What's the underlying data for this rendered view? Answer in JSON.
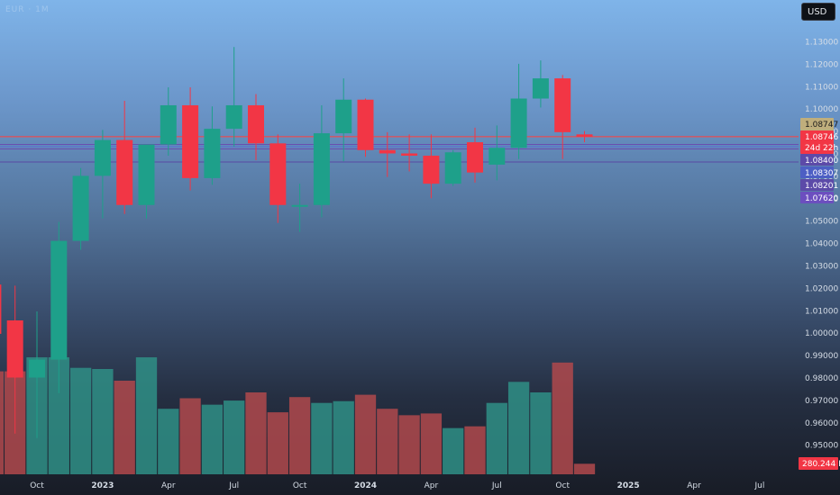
{
  "header": {
    "symbol_text": "EUR · 1M",
    "currency_button": "USD"
  },
  "colors": {
    "up": "#1ea08a",
    "down": "#f23645",
    "vol_up": "#2f8f86",
    "vol_down": "#b0494c"
  },
  "chart_data": {
    "type": "candlestick",
    "timeframe": "monthly",
    "y_axis": {
      "min": 0.94,
      "max": 1.14,
      "tick_labels": [
        "1.13000",
        "1.12000",
        "1.11000",
        "1.10000",
        "1.09000",
        "1.08000",
        "1.07000",
        "1.06000",
        "1.05000",
        "1.04000",
        "1.03000",
        "1.02000",
        "1.01000",
        "1.00000",
        "0.99000",
        "0.98000",
        "0.97000",
        "0.96000",
        "0.95000"
      ]
    },
    "x_axis": {
      "labels": [
        {
          "text": "Oct",
          "month": 0,
          "bold": false
        },
        {
          "text": "2023",
          "month": 3,
          "bold": true
        },
        {
          "text": "Apr",
          "month": 6,
          "bold": false
        },
        {
          "text": "Jul",
          "month": 9,
          "bold": false
        },
        {
          "text": "Oct",
          "month": 12,
          "bold": false
        },
        {
          "text": "2024",
          "month": 15,
          "bold": true
        },
        {
          "text": "Apr",
          "month": 18,
          "bold": false
        },
        {
          "text": "Jul",
          "month": 21,
          "bold": false
        },
        {
          "text": "Oct",
          "month": 24,
          "bold": false
        },
        {
          "text": "2025",
          "month": 27,
          "bold": true
        },
        {
          "text": "Apr",
          "month": 30,
          "bold": false
        },
        {
          "text": "Jul",
          "month": 33,
          "bold": false
        }
      ]
    },
    "candles": [
      {
        "month": -2,
        "o": 1.0215,
        "h": 1.0225,
        "l": 0.955,
        "c": 0.9995
      },
      {
        "month": -1,
        "o": 1.0055,
        "h": 1.021,
        "l": 0.955,
        "c": 0.98
      },
      {
        "month": 0,
        "o": 0.98,
        "h": 1.0095,
        "l": 0.953,
        "c": 0.988
      },
      {
        "month": 1,
        "o": 0.988,
        "h": 1.0495,
        "l": 0.973,
        "c": 1.041
      },
      {
        "month": 2,
        "o": 1.041,
        "h": 1.0735,
        "l": 1.037,
        "c": 1.07
      },
      {
        "month": 3,
        "o": 1.07,
        "h": 1.0905,
        "l": 1.051,
        "c": 1.086
      },
      {
        "month": 4,
        "o": 1.086,
        "h": 1.1035,
        "l": 1.053,
        "c": 1.057
      },
      {
        "month": 5,
        "o": 1.057,
        "h": 1.0835,
        "l": 1.051,
        "c": 1.084
      },
      {
        "month": 6,
        "o": 1.084,
        "h": 1.1095,
        "l": 1.079,
        "c": 1.1015
      },
      {
        "month": 7,
        "o": 1.1015,
        "h": 1.1095,
        "l": 1.0635,
        "c": 1.069
      },
      {
        "month": 8,
        "o": 1.069,
        "h": 1.101,
        "l": 1.066,
        "c": 1.091
      },
      {
        "month": 9,
        "o": 1.091,
        "h": 1.1275,
        "l": 1.083,
        "c": 1.1015
      },
      {
        "month": 10,
        "o": 1.1015,
        "h": 1.1065,
        "l": 1.077,
        "c": 1.0845
      },
      {
        "month": 11,
        "o": 1.0845,
        "h": 1.0885,
        "l": 1.049,
        "c": 1.057
      },
      {
        "month": 12,
        "o": 1.057,
        "h": 1.0665,
        "l": 1.045,
        "c": 1.057
      },
      {
        "month": 13,
        "o": 1.057,
        "h": 1.1015,
        "l": 1.0515,
        "c": 1.089
      },
      {
        "month": 14,
        "o": 1.089,
        "h": 1.1135,
        "l": 1.0765,
        "c": 1.104
      },
      {
        "month": 15,
        "o": 1.104,
        "h": 1.1045,
        "l": 1.0785,
        "c": 1.0815
      },
      {
        "month": 16,
        "o": 1.0815,
        "h": 1.0895,
        "l": 1.0695,
        "c": 1.08
      },
      {
        "month": 17,
        "o": 1.08,
        "h": 1.0885,
        "l": 1.072,
        "c": 1.079
      },
      {
        "month": 18,
        "o": 1.079,
        "h": 1.0885,
        "l": 1.06,
        "c": 1.0665
      },
      {
        "month": 19,
        "o": 1.0665,
        "h": 1.0815,
        "l": 1.0655,
        "c": 1.0805
      },
      {
        "month": 20,
        "o": 1.085,
        "h": 1.0915,
        "l": 1.067,
        "c": 1.0715
      },
      {
        "month": 21,
        "o": 1.075,
        "h": 1.0925,
        "l": 1.068,
        "c": 1.0825
      },
      {
        "month": 22,
        "o": 1.0825,
        "h": 1.12,
        "l": 1.0775,
        "c": 1.1045
      },
      {
        "month": 23,
        "o": 1.1045,
        "h": 1.1215,
        "l": 1.1005,
        "c": 1.1135
      },
      {
        "month": 24,
        "o": 1.1135,
        "h": 1.115,
        "l": 1.0775,
        "c": 1.0895
      },
      {
        "month": 25,
        "o": 1.0885,
        "h": 1.09,
        "l": 1.085,
        "c": 1.0875
      }
    ],
    "volume": {
      "label": "280.244 K",
      "bars": [
        {
          "month": -2,
          "v": 880,
          "up": false
        },
        {
          "month": -1,
          "v": 880,
          "up": false
        },
        {
          "month": 0,
          "v": 1000,
          "up": true
        },
        {
          "month": 1,
          "v": 1000,
          "up": true
        },
        {
          "month": 2,
          "v": 910,
          "up": true
        },
        {
          "month": 3,
          "v": 900,
          "up": true
        },
        {
          "month": 4,
          "v": 800,
          "up": false
        },
        {
          "month": 5,
          "v": 1000,
          "up": true
        },
        {
          "month": 6,
          "v": 560,
          "up": true
        },
        {
          "month": 7,
          "v": 650,
          "up": false
        },
        {
          "month": 8,
          "v": 595,
          "up": true
        },
        {
          "month": 9,
          "v": 630,
          "up": true
        },
        {
          "month": 10,
          "v": 700,
          "up": false
        },
        {
          "month": 11,
          "v": 530,
          "up": false
        },
        {
          "month": 12,
          "v": 660,
          "up": false
        },
        {
          "month": 13,
          "v": 610,
          "up": true
        },
        {
          "month": 14,
          "v": 625,
          "up": true
        },
        {
          "month": 15,
          "v": 680,
          "up": false
        },
        {
          "month": 16,
          "v": 560,
          "up": false
        },
        {
          "month": 17,
          "v": 505,
          "up": false
        },
        {
          "month": 18,
          "v": 520,
          "up": false
        },
        {
          "month": 19,
          "v": 395,
          "up": true
        },
        {
          "month": 20,
          "v": 410,
          "up": false
        },
        {
          "month": 21,
          "v": 610,
          "up": true
        },
        {
          "month": 22,
          "v": 790,
          "up": true
        },
        {
          "month": 23,
          "v": 700,
          "up": true
        },
        {
          "month": 24,
          "v": 955,
          "up": false
        },
        {
          "month": 25,
          "v": 90,
          "up": false
        }
      ]
    },
    "price_lines": [
      {
        "value": 1.08747,
        "color": "#c8b98a",
        "label": "1.08747",
        "label_bg": "#bfae7c",
        "label_fg": "#1a1a1a"
      },
      {
        "value": 1.08746,
        "color": "#f23645",
        "label": "1.08746",
        "label_bg": "#f23645",
        "label_fg": "#ffffff",
        "sublabel": "24d 22h"
      },
      {
        "value": 1.084,
        "color": "#6a4fb0",
        "label": "1.08400",
        "label_bg": "#5c4aa8",
        "label_fg": "#ffffff"
      },
      {
        "value": 1.08307,
        "color": "#5b6ed6",
        "label": "1.08307",
        "label_bg": "#4d5fc4",
        "label_fg": "#ffffff"
      },
      {
        "value": 1.08201,
        "color": "#6a4fb0",
        "label": "1.08201",
        "label_bg": "#5c4aa8",
        "label_fg": "#ffffff"
      },
      {
        "value": 1.0762,
        "color": "#5a4aa3",
        "label": "1.07620",
        "label_bg": "#6c4fbf",
        "label_fg": "#ffffff"
      }
    ]
  }
}
